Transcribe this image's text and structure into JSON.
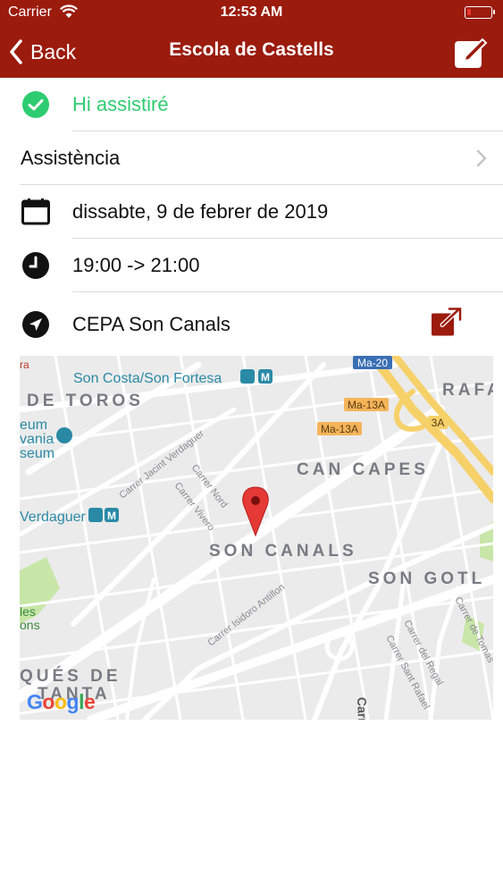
{
  "status_bar": {
    "carrier": "Carrier",
    "time": "12:53 AM"
  },
  "nav": {
    "back_label": "Back",
    "title": "Escola de Castells"
  },
  "rows": {
    "attendance_status": "Hi assistiré",
    "assistance": "Assistència",
    "date": "dissabte, 9 de febrer de 2019",
    "time_range": "19:00 -> 21:00",
    "location": "CEPA Son Canals"
  },
  "map": {
    "labels": {
      "metro": "Son Costa/Son Fortesa",
      "toros": "DE TOROS",
      "rafa": "RAFA",
      "can_capes": "CAN CAPES",
      "son_canals": "SON CANALS",
      "son_gotl": "SON GOTL",
      "ques_de": "QUÉS DE",
      "tanta": "TANTA",
      "verdaguer": "Verdaguer",
      "museum1": "eum",
      "museum2": "vania",
      "museum3": "seum",
      "les": "les",
      "ons": "ons",
      "ra": "ra",
      "ma20": "Ma-20",
      "ma13a_1": "Ma-13A",
      "ma13a_2": "Ma-13A",
      "r3a": "3A",
      "st_jacint": "Carrer Jacint Verdaguer",
      "st_nord": "Carrer Nord",
      "st_vivero": "Carrer Vivero",
      "st_isidoro": "Carrer Isidoro Antillon",
      "st_regal": "Carrer del Regal",
      "st_sant_rafael": "Carrer Sant Rafael",
      "st_tomas": "Carrer de Tomas",
      "st_carr": "Carr"
    },
    "google": [
      "G",
      "o",
      "o",
      "g",
      "l",
      "e"
    ]
  },
  "colors": {
    "nav_bg": "#9b1b0d",
    "attended_green": "#2ecc71",
    "external_link_red": "#9b1b0d",
    "marker_red": "#e53935"
  }
}
